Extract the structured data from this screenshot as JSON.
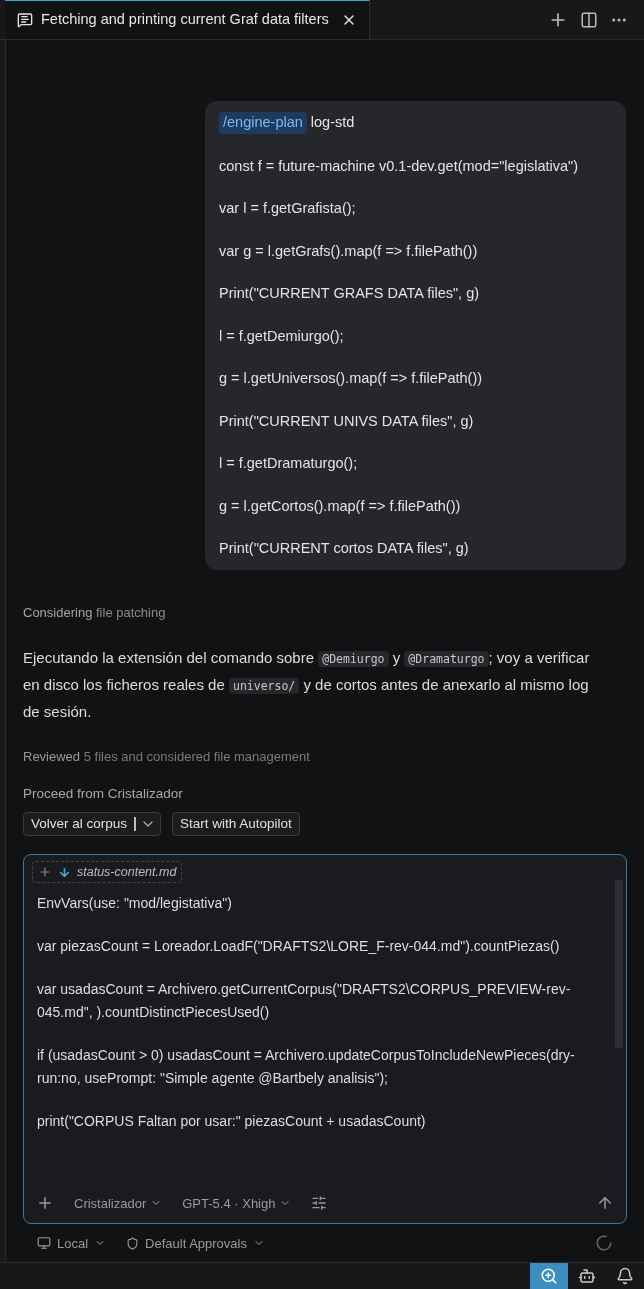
{
  "tab": {
    "title": "Fetching and printing current Graf data filters",
    "selected": true
  },
  "user_message": {
    "command": "/engine-plan",
    "command_rest": "log-std",
    "lines": [
      "const f = future-machine v0.1-dev.get(mod=\"legislativa\")",
      "var l = f.getGrafista();",
      "var g = l.getGrafs().map(f => f.filePath())",
      "Print(\"CURRENT GRAFS DATA files\", g)",
      "l = f.getDemiurgo();",
      "g = l.getUniversos().map(f => f.filePath())",
      "Print(\"CURRENT UNIVS DATA files\", g)",
      "l = f.getDramaturgo();",
      "g = l.getCortos().map(f => f.filePath())",
      "Print(\"CURRENT cortos DATA files\", g)"
    ]
  },
  "status_1": {
    "lead": "Considering",
    "rest": "file patching"
  },
  "reply": [
    {
      "kind": "text",
      "text": "Ejecutando la extensión del comando sobre "
    },
    {
      "kind": "code",
      "text": "@Demiurgo"
    },
    {
      "kind": "text",
      "text": " y "
    },
    {
      "kind": "code",
      "text": "@Dramaturgo"
    },
    {
      "kind": "text",
      "text": "; voy a verificar en disco los ficheros reales de "
    },
    {
      "kind": "code",
      "text": "universo/"
    },
    {
      "kind": "text",
      "text": " y de cortos antes de anexarlo al mismo log de sesión."
    }
  ],
  "status_2": {
    "lead": "Reviewed",
    "rest": "5 files and considered file management"
  },
  "proceed": {
    "label": "Proceed from Cristalizador",
    "primary": "Volver al corpus",
    "secondary": "Start with Autopilot"
  },
  "composer": {
    "attachment": "status-content.md",
    "paragraphs": [
      "EnvVars(use: \"mod/legistativa\")",
      "var piezasCount = Loreador.LoadF(\"DRAFTS2\\LORE_F-rev-044.md\").countPiezas()",
      "var usadasCount = Archivero.getCurrentCorpus(\"DRAFTS2\\CORPUS_PREVIEW-rev-045.md\", ).countDistinctPiecesUsed()",
      "if (usadasCount > 0) usadasCount = Archivero.updateCorpusToIncludeNewPieces(dry-run:no, usePrompt: \"Simple agente @Bartbely analisis\");",
      "print(\"CORPUS Faltan por usar:\" piezasCount +  usadasCount)"
    ],
    "agent": "Cristalizador",
    "model": "GPT-5.4 · Xhigh"
  },
  "footer": {
    "location": "Local",
    "approvals": "Default Approvals"
  },
  "status_bar": {
    "zoom_selected": true
  }
}
